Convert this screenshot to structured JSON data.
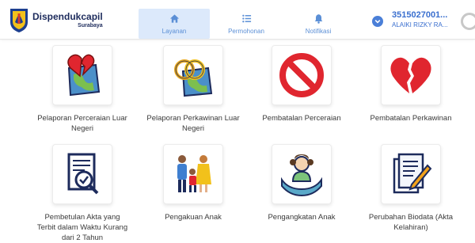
{
  "brand": {
    "name": "Dispendukcapil",
    "city": "Surabaya",
    "logo_icon": "surabaya-shield-logo"
  },
  "nav": [
    {
      "label": "Layanan",
      "icon": "home-icon",
      "active": true
    },
    {
      "label": "Permohonan",
      "icon": "list-icon",
      "active": false
    },
    {
      "label": "Notifikasi",
      "icon": "bell-icon",
      "active": false
    }
  ],
  "user": {
    "nik": "3515027001...",
    "name": "ALAIKI RIZKY RA..."
  },
  "services": [
    {
      "label": "Pelaporan Perceraian Luar Negeri",
      "icon": "broken-heart-globe-icon"
    },
    {
      "label": "Pelaporan Perkawinan Luar Negeri",
      "icon": "rings-globe-icon"
    },
    {
      "label": "Pembatalan Perceraian",
      "icon": "prohibited-sign-icon"
    },
    {
      "label": "Pembatalan Perkawinan",
      "icon": "broken-heart-icon"
    },
    {
      "label": "Pembetulan Akta yang Terbit dalam Waktu Kurang dari 2 Tahun",
      "icon": "document-magnifier-icon"
    },
    {
      "label": "Pengakuan Anak",
      "icon": "family-icon"
    },
    {
      "label": "Pengangkatan Anak",
      "icon": "child-in-hands-icon"
    },
    {
      "label": "Perubahan Biodata (Akta Kelahiran)",
      "icon": "document-pen-icon"
    }
  ],
  "colors": {
    "accent": "#3a6fcf",
    "active_nav_bg": "#dce9fb",
    "heart_red": "#e0262f"
  }
}
